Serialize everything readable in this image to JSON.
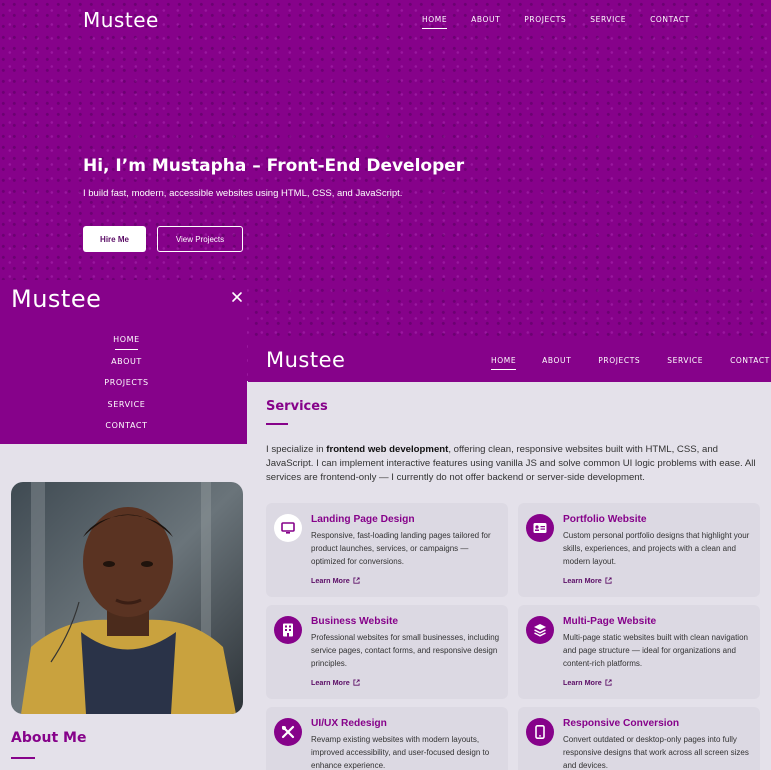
{
  "brand": {
    "name": "Mustee"
  },
  "nav": {
    "home": "HOME",
    "about": "ABOUT",
    "projects": "PROJECTS",
    "service": "SERVICE",
    "contact": "CONTACT"
  },
  "hero": {
    "title": "Hi, I’m Mustapha – Front-End Developer",
    "subtitle": "I build fast, modern, accessible websites using HTML, CSS, and JavaScript.",
    "hire_button": "Hire Me",
    "projects_button": "View Projects"
  },
  "about": {
    "title": "About Me"
  },
  "services": {
    "title": "Services",
    "intro_pre": "I specialize in ",
    "intro_bold": "frontend web development",
    "intro_post": ", offering clean, responsive websites built with HTML, CSS, and JavaScript. I can implement interactive features using vanilla JS and solve common UI logic problems with ease. All services are frontend-only — I currently do not offer backend or server-side development.",
    "learn_more": "Learn More",
    "cards": [
      {
        "title": "Landing Page Design",
        "desc": "Responsive, fast-loading landing pages tailored for product launches, services, or campaigns — optimized for conversions.",
        "icon": "monitor-icon"
      },
      {
        "title": "Portfolio Website",
        "desc": "Custom personal portfolio designs that highlight your skills, experiences, and projects with a clean and modern layout.",
        "icon": "id-card-icon"
      },
      {
        "title": "Business Website",
        "desc": "Professional websites for small businesses, including service pages, contact forms, and responsive design principles.",
        "icon": "building-icon"
      },
      {
        "title": "Multi-Page Website",
        "desc": "Multi-page static websites built with clean navigation and page structure — ideal for organizations and content-rich platforms.",
        "icon": "layers-icon"
      },
      {
        "title": "UI/UX Redesign",
        "desc": "Revamp existing websites with modern layouts, improved accessibility, and user-focused design to enhance experience.",
        "icon": "tools-icon"
      },
      {
        "title": "Responsive Conversion",
        "desc": "Convert outdated or desktop-only pages into fully responsive designs that work across all screen sizes and devices.",
        "icon": "mobile-icon"
      }
    ]
  },
  "colors": {
    "brand_purple": "#86028a",
    "page_bg": "#e4e1ea",
    "card_bg": "#dcd9e3"
  }
}
